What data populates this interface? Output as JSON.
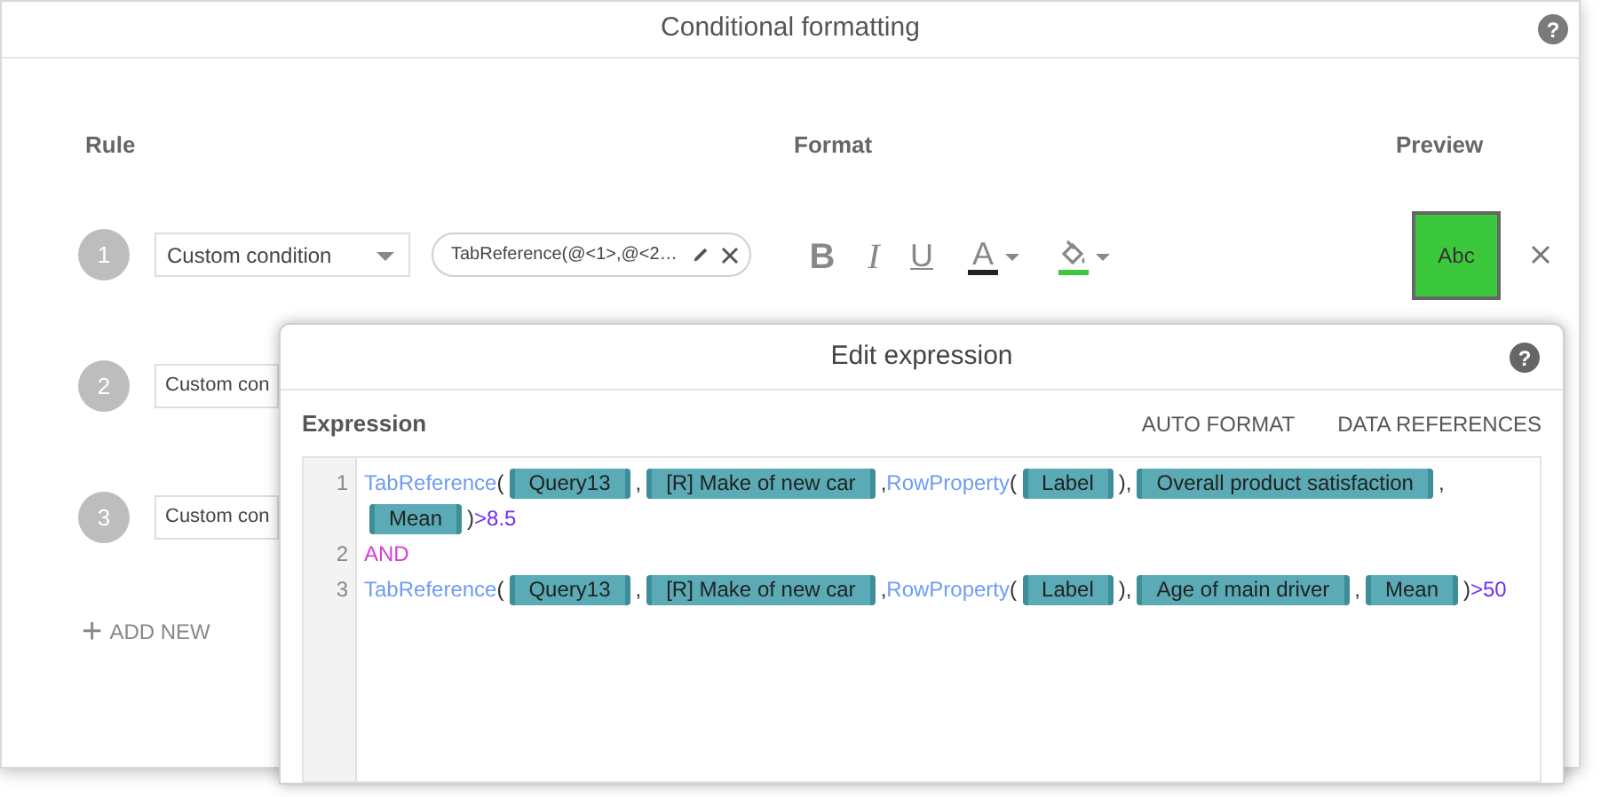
{
  "dialog": {
    "title": "Conditional formatting",
    "help": "?"
  },
  "columns": [
    "Rule",
    "Format",
    "Preview"
  ],
  "rules": [
    {
      "number": "1",
      "condition": "Custom condition",
      "expression": "TabReference(@<1>,@<2…",
      "format": {
        "bold": "B",
        "italic": "I",
        "underline": "U",
        "font_color_glyph": "A"
      },
      "preview": {
        "text": "Abc",
        "color": "#3cc83c"
      }
    },
    {
      "number": "2",
      "condition": "Custom con"
    },
    {
      "number": "3",
      "condition": "Custom con"
    }
  ],
  "add_new": {
    "icon": "+",
    "label": "ADD NEW"
  },
  "editor": {
    "title": "Edit expression",
    "help": "?",
    "label": "Expression",
    "actions": [
      "AUTO FORMAT",
      "DATA REFERENCES"
    ],
    "lines": [
      {
        "number": "1",
        "tokens": [
          {
            "kind": "func",
            "text": "TabReference"
          },
          {
            "kind": "punct",
            "text": "("
          },
          {
            "kind": "ref",
            "text": "Query13"
          },
          {
            "kind": "punct",
            "text": ","
          },
          {
            "kind": "ref",
            "text": "[R] Make of new car"
          },
          {
            "kind": "punct",
            "text": ","
          },
          {
            "kind": "func",
            "text": "RowProperty"
          },
          {
            "kind": "punct",
            "text": "("
          },
          {
            "kind": "ref",
            "text": "Label"
          },
          {
            "kind": "punct",
            "text": "),"
          },
          {
            "kind": "ref",
            "text": "Overall product satisfaction"
          },
          {
            "kind": "punct",
            "text": ","
          },
          {
            "kind": "ref",
            "text": "Mean"
          },
          {
            "kind": "punct",
            "text": ")"
          },
          {
            "kind": "number",
            "text": ">8.5"
          }
        ]
      },
      {
        "number": "2",
        "tokens": [
          {
            "kind": "keyword",
            "text": "AND"
          }
        ]
      },
      {
        "number": "3",
        "tokens": [
          {
            "kind": "func",
            "text": "TabReference"
          },
          {
            "kind": "punct",
            "text": "("
          },
          {
            "kind": "ref",
            "text": "Query13"
          },
          {
            "kind": "punct",
            "text": ","
          },
          {
            "kind": "ref",
            "text": "[R] Make of new car"
          },
          {
            "kind": "punct",
            "text": ","
          },
          {
            "kind": "func",
            "text": "RowProperty"
          },
          {
            "kind": "punct",
            "text": "("
          },
          {
            "kind": "ref",
            "text": "Label"
          },
          {
            "kind": "punct",
            "text": "),"
          },
          {
            "kind": "ref",
            "text": "Age of main driver"
          },
          {
            "kind": "punct",
            "text": ","
          },
          {
            "kind": "ref",
            "text": "Mean"
          },
          {
            "kind": "punct",
            "text": ")"
          },
          {
            "kind": "number",
            "text": ">50"
          }
        ]
      }
    ]
  }
}
